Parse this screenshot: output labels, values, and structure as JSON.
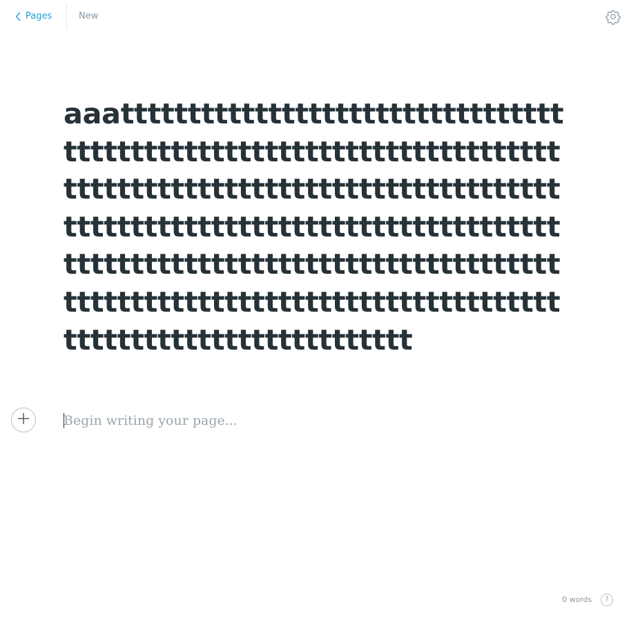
{
  "header": {
    "back_label": "Pages",
    "status_label": "New",
    "back_icon": "chevron-left-icon",
    "settings_icon": "gear-icon"
  },
  "document": {
    "title": "aaatttttttttttttttttttttttttttttttttttttttttttttttttttttttttttttttttttttttttttttttttttttttttttttttttttttttttttttttttttttttttttttttttttttttttttttttttttttttttttttttttttttttttttttttttttttttttttttttttttttttttttttttttttttttttttttttttttttttttttttttttttt",
    "body_placeholder": "Begin writing your page...",
    "add_block_icon": "plus-icon"
  },
  "footer": {
    "word_count": "0 words",
    "help_label": "?"
  },
  "colors": {
    "accent": "#1f9dd9",
    "text": "#263238",
    "muted": "#8a97a0"
  }
}
